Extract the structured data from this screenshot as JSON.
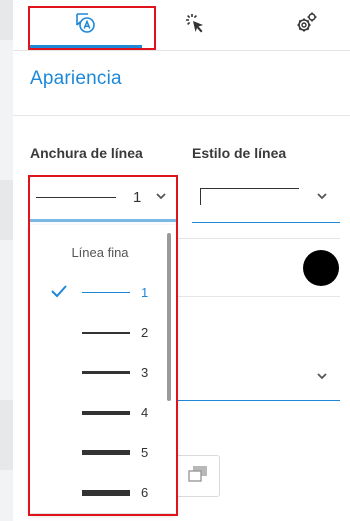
{
  "tabs": [
    {
      "name": "appearance",
      "icon": "appearance-icon",
      "active": true
    },
    {
      "name": "effects",
      "icon": "cursor-click-icon",
      "active": false
    },
    {
      "name": "settings",
      "icon": "gears-icon",
      "active": false
    }
  ],
  "section": {
    "title": "Apariencia"
  },
  "line_width": {
    "label": "Anchura de línea",
    "selected_value": "1"
  },
  "line_style": {
    "label": "Estilo de línea"
  },
  "dropdown": {
    "header": "Línea fina",
    "options": [
      {
        "value": "1",
        "selected": true
      },
      {
        "value": "2",
        "selected": false
      },
      {
        "value": "3",
        "selected": false
      },
      {
        "value": "4",
        "selected": false
      },
      {
        "value": "5",
        "selected": false
      },
      {
        "value": "6",
        "selected": false
      }
    ]
  },
  "colors": {
    "accent": "#1e88d8",
    "highlight": "#e0121b",
    "line_color": "#000000"
  }
}
